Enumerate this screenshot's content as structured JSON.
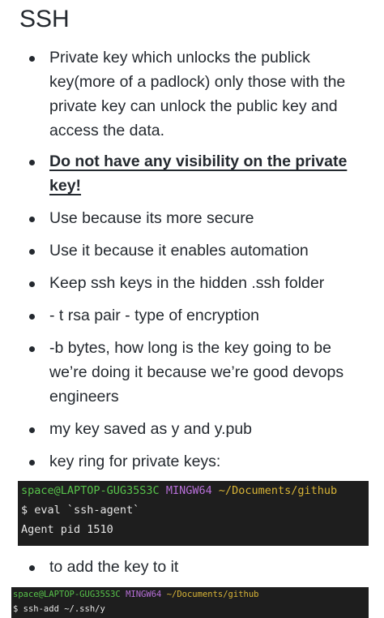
{
  "title": "SSH",
  "notes": [
    {
      "text": "Private key which unlocks the publick key(more of a padlock) only those with the private key can unlock the public key and access the data."
    },
    {
      "text": "Do not have any visibility on the private key!",
      "bold": true
    },
    {
      "text": "Use because its more secure"
    },
    {
      "text": "Use it because it enables automation"
    },
    {
      "text": "Keep ssh keys in the hidden .ssh folder"
    },
    {
      "text": "- t rsa pair - type of encryption"
    },
    {
      "text": "-b bytes, how long is the key going to be we’re doing it because we’re good devops engineers"
    },
    {
      "text": "my key saved as y and y.pub"
    },
    {
      "text": "key ring for private keys:"
    },
    {
      "text": "to add the key to it"
    }
  ],
  "terminal1": {
    "user": "space@LAPTOP-GUG35S3C",
    "host": "MINGW64",
    "path": "~/Documents/github",
    "command": "$ eval `ssh-agent`",
    "output": "Agent pid 1510"
  },
  "terminal2": {
    "user": "space@LAPTOP-GUG35S3C",
    "host": "MINGW64",
    "path": "~/Documents/github",
    "command": "$ ssh-add ~/.ssh/y"
  },
  "colors": {
    "terminal_bg": "#1e1e1e",
    "prompt_user": "#57c24a",
    "prompt_host": "#b76fd8",
    "prompt_path": "#d8b437"
  }
}
